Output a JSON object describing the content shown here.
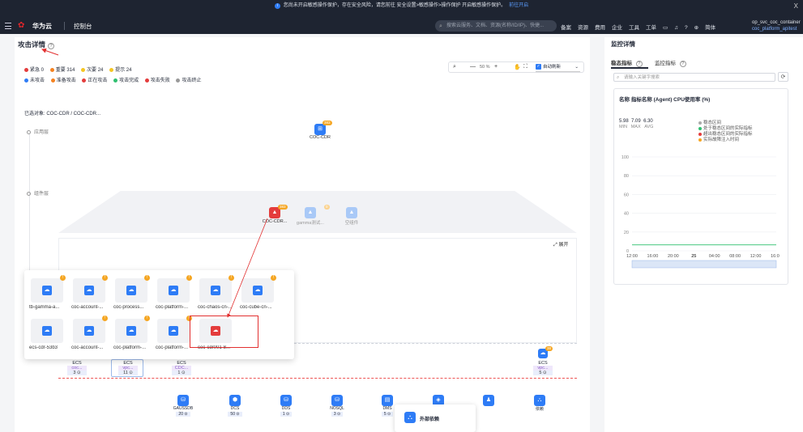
{
  "banner": {
    "text": "您尚未开启敏感操作保护，存在安全风险，请您前往 安全设置>敏感操作>操作保护 开启敏感操作保护。",
    "link": "前往开启",
    "close": "X"
  },
  "nav": {
    "brand": "华为云",
    "console": "控制台",
    "search_placeholder": "搜索云服务、文档、资源(名称/ID/IP)、快捷...",
    "links": [
      "备案",
      "资源",
      "费用",
      "企业",
      "工具",
      "工单"
    ],
    "language": "简体",
    "account": "op_svc_coc_container",
    "account_sub": "coc_platform_apitest"
  },
  "page": {
    "title": "攻击详情",
    "help": "?"
  },
  "severity_legend": [
    {
      "label": "紧急 0",
      "color": "#e43c3c"
    },
    {
      "label": "重要 314",
      "color": "#f58220"
    },
    {
      "label": "次要 24",
      "color": "#f5c623"
    },
    {
      "label": "提示 24",
      "color": "#f5c623"
    }
  ],
  "status_legend": [
    {
      "label": "未攻击",
      "color": "#2e7cf6"
    },
    {
      "label": "准备攻击",
      "color": "#f58220"
    },
    {
      "label": "正在攻击",
      "color": "#e43c3c"
    },
    {
      "label": "攻击完成",
      "color": "#2ebf6f"
    },
    {
      "label": "攻击失败",
      "color": "#e43c3c"
    },
    {
      "label": "攻击终止",
      "color": "#999999"
    }
  ],
  "toolbar": {
    "zoom": "50 %",
    "minus": "—",
    "plus": "+",
    "auto_refresh": "自动刷新"
  },
  "topology": {
    "selected_target": "已选对象: COC-CDR / COC-CDR...",
    "app_layer": "应用层",
    "component_layer": "组件层",
    "app_node": {
      "label": "COC-CDR",
      "badge": "383"
    },
    "component_nodes": [
      {
        "label": "COC-CDR...",
        "badge": "383",
        "state": "red"
      },
      {
        "label": "gamma测试...",
        "badge": "0",
        "state": "light"
      },
      {
        "label": "空组件",
        "badge": "",
        "state": "light"
      }
    ],
    "expand": "展开"
  },
  "popup_cards": [
    {
      "label": "tb-gamma-a...",
      "warn": "!",
      "state": "blue"
    },
    {
      "label": "coc-account-...",
      "warn": "!",
      "state": "blue"
    },
    {
      "label": "coc-process...",
      "warn": "!",
      "state": "blue"
    },
    {
      "label": "coc-platform-...",
      "warn": "!",
      "state": "blue"
    },
    {
      "label": "coc-chaos-cn-...",
      "warn": "!",
      "state": "blue"
    },
    {
      "label": "coc-cube-cn-...",
      "warn": "!",
      "state": "blue"
    },
    {
      "label": "ecs-cdr-53b3",
      "warn": "",
      "state": "blue"
    },
    {
      "label": "coc-account-...",
      "warn": "!",
      "state": "blue"
    },
    {
      "label": "coc-platform-...",
      "warn": "!",
      "state": "blue"
    },
    {
      "label": "coc-platform-...",
      "warn": "!",
      "state": "blue"
    },
    {
      "label": "coc-cdr001-8...",
      "warn": "",
      "state": "red"
    }
  ],
  "ecs_groups": [
    {
      "type": "ECS",
      "vpc": "coc...",
      "count": "3 ⊙"
    },
    {
      "type": "ECS",
      "vpc": "vpc...",
      "count": "11 ⊙"
    },
    {
      "type": "ECS",
      "vpc": "CDC...",
      "count": "1 ⊙"
    },
    {
      "type": "ECS",
      "vpc": "vpc...",
      "count": "5 ⊙",
      "badge": "38"
    }
  ],
  "db_nodes": [
    {
      "label": "GAUSSDB",
      "count": "20 ⊙"
    },
    {
      "label": "DCS",
      "count": "50 ⊙"
    },
    {
      "label": "DDS",
      "count": "1 ⊙"
    },
    {
      "label": "NOSQL",
      "count": "3 ⊙"
    },
    {
      "label": "DMS",
      "count": "5 ⊙"
    },
    {
      "label": "",
      "count": ""
    },
    {
      "label": "",
      "count": ""
    },
    {
      "label": "依赖",
      "count": ""
    }
  ],
  "external_dep": "外部依赖",
  "monitor": {
    "title": "监控详情",
    "tabs": [
      "稳态指标",
      "监控指标"
    ],
    "search_placeholder": "请输入关键字搜索",
    "metric_title_prefix": "名称",
    "metric_title": "指标名称 (Agent) CPU使用率 (%)",
    "baseline_label": "",
    "stats": {
      "min": "5.98",
      "max": "7.09",
      "avg": "6.30",
      "min_label": "MIN",
      "max_label": "MAX",
      "avg_label": "AVG"
    },
    "legend": [
      {
        "label": "稳态区间",
        "color": "#aaaaaa"
      },
      {
        "label": "处于稳态区间的实际指标",
        "color": "#2ebf6f"
      },
      {
        "label": "超出稳态区间的实际指标",
        "color": "#e43c3c"
      },
      {
        "label": "实际故障注入时间",
        "color": "#f5a623"
      }
    ]
  },
  "chart_data": {
    "type": "line",
    "x": [
      "12:00",
      "16:00",
      "20:00",
      "25",
      "04:00",
      "08:00",
      "12:00",
      "16:00"
    ],
    "series": [
      {
        "values": [
          6.3,
          6.3,
          6.3,
          6.3,
          6.3,
          6.3,
          6.3,
          6.3
        ]
      }
    ],
    "ylim": [
      0,
      100
    ],
    "yticks": [
      0,
      20,
      40,
      60,
      80,
      100
    ],
    "title": "",
    "xlabel": "",
    "ylabel": ""
  }
}
